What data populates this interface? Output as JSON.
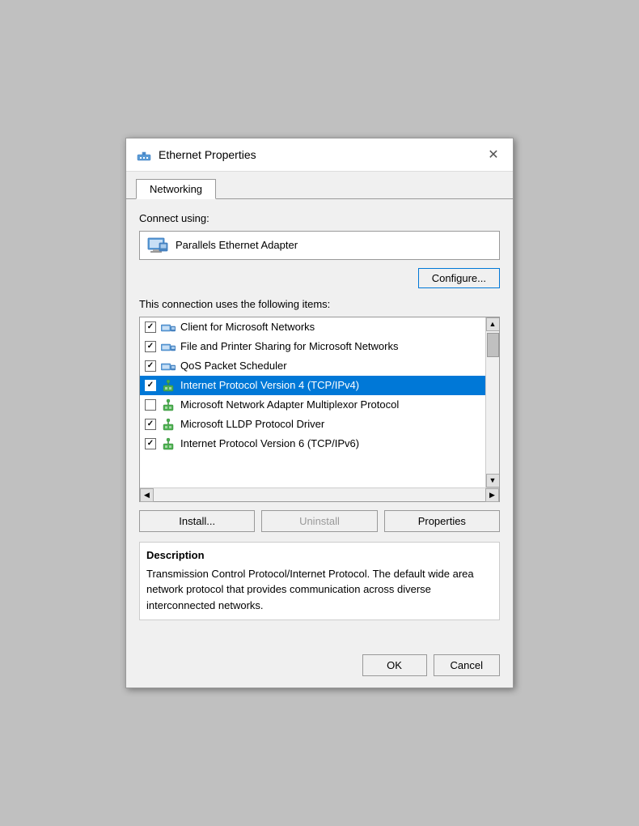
{
  "window": {
    "title": "Ethernet Properties",
    "icon": "network-adapter-icon",
    "close_label": "✕"
  },
  "tabs": [
    {
      "label": "Networking",
      "active": true
    }
  ],
  "connect_using_label": "Connect using:",
  "adapter": {
    "name": "Parallels Ethernet Adapter",
    "icon": "adapter-icon"
  },
  "configure_button": "Configure...",
  "items_label": "This connection uses the following items:",
  "items": [
    {
      "checked": true,
      "icon": "network-icon-blue",
      "label": "Client for Microsoft Networks"
    },
    {
      "checked": true,
      "icon": "network-icon-blue",
      "label": "File and Printer Sharing for Microsoft Networks"
    },
    {
      "checked": true,
      "icon": "network-icon-blue",
      "label": "QoS Packet Scheduler"
    },
    {
      "checked": true,
      "icon": "network-icon-green",
      "label": "Internet Protocol Version 4 (TCP/IPv4)",
      "selected": true
    },
    {
      "checked": false,
      "icon": "network-icon-green",
      "label": "Microsoft Network Adapter Multiplexor Protocol"
    },
    {
      "checked": true,
      "icon": "network-icon-green",
      "label": "Microsoft LLDP Protocol Driver"
    },
    {
      "checked": true,
      "icon": "network-icon-green",
      "label": "Internet Protocol Version 6 (TCP/IPv6)"
    }
  ],
  "action_buttons": {
    "install": "Install...",
    "uninstall": "Uninstall",
    "properties": "Properties"
  },
  "description": {
    "title": "Description",
    "text": "Transmission Control Protocol/Internet Protocol. The default wide area network protocol that provides communication across diverse interconnected networks."
  },
  "footer": {
    "ok": "OK",
    "cancel": "Cancel"
  }
}
